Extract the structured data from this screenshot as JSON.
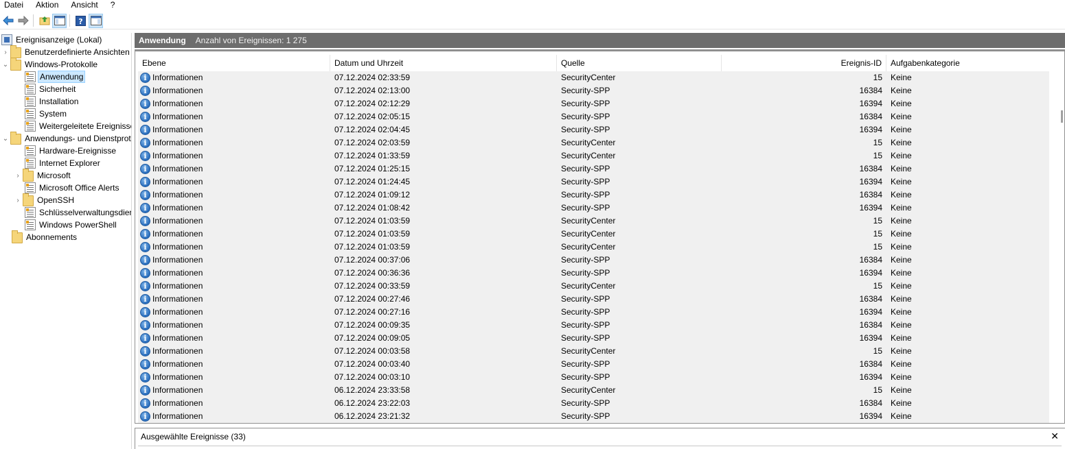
{
  "menu": [
    "Datei",
    "Aktion",
    "Ansicht",
    "?"
  ],
  "toolbar": {
    "back_icon": "back-arrow-icon",
    "forward_icon": "forward-arrow-icon",
    "up_icon": "folder-up-icon",
    "console_icon": "console-tree-icon",
    "help_icon": "help-icon",
    "panel_icon": "action-pane-icon"
  },
  "tree": {
    "root": "Ereignisanzeige (Lokal)",
    "custom_views": "Benutzerdefinierte Ansichten",
    "windows_logs": "Windows-Protokolle",
    "windows_logs_items": [
      "Anwendung",
      "Sicherheit",
      "Installation",
      "System",
      "Weitergeleitete Ereignisse"
    ],
    "app_service_logs": "Anwendungs- und Dienstprotokolle",
    "app_service_items": [
      "Hardware-Ereignisse",
      "Internet Explorer",
      "Microsoft",
      "Microsoft Office Alerts",
      "OpenSSH",
      "Schlüsselverwaltungsdienst",
      "Windows PowerShell"
    ],
    "subscriptions": "Abonnements"
  },
  "main": {
    "title": "Anwendung",
    "event_count": "Anzahl von Ereignissen: 1 275",
    "columns": [
      "Ebene",
      "Datum und Uhrzeit",
      "Quelle",
      "Ereignis-ID",
      "Aufgabenkategorie"
    ],
    "rows": [
      [
        "Informationen",
        "07.12.2024 02:33:59",
        "SecurityCenter",
        "15",
        "Keine"
      ],
      [
        "Informationen",
        "07.12.2024 02:13:00",
        "Security-SPP",
        "16384",
        "Keine"
      ],
      [
        "Informationen",
        "07.12.2024 02:12:29",
        "Security-SPP",
        "16394",
        "Keine"
      ],
      [
        "Informationen",
        "07.12.2024 02:05:15",
        "Security-SPP",
        "16384",
        "Keine"
      ],
      [
        "Informationen",
        "07.12.2024 02:04:45",
        "Security-SPP",
        "16394",
        "Keine"
      ],
      [
        "Informationen",
        "07.12.2024 02:03:59",
        "SecurityCenter",
        "15",
        "Keine"
      ],
      [
        "Informationen",
        "07.12.2024 01:33:59",
        "SecurityCenter",
        "15",
        "Keine"
      ],
      [
        "Informationen",
        "07.12.2024 01:25:15",
        "Security-SPP",
        "16384",
        "Keine"
      ],
      [
        "Informationen",
        "07.12.2024 01:24:45",
        "Security-SPP",
        "16394",
        "Keine"
      ],
      [
        "Informationen",
        "07.12.2024 01:09:12",
        "Security-SPP",
        "16384",
        "Keine"
      ],
      [
        "Informationen",
        "07.12.2024 01:08:42",
        "Security-SPP",
        "16394",
        "Keine"
      ],
      [
        "Informationen",
        "07.12.2024 01:03:59",
        "SecurityCenter",
        "15",
        "Keine"
      ],
      [
        "Informationen",
        "07.12.2024 01:03:59",
        "SecurityCenter",
        "15",
        "Keine"
      ],
      [
        "Informationen",
        "07.12.2024 01:03:59",
        "SecurityCenter",
        "15",
        "Keine"
      ],
      [
        "Informationen",
        "07.12.2024 00:37:06",
        "Security-SPP",
        "16384",
        "Keine"
      ],
      [
        "Informationen",
        "07.12.2024 00:36:36",
        "Security-SPP",
        "16394",
        "Keine"
      ],
      [
        "Informationen",
        "07.12.2024 00:33:59",
        "SecurityCenter",
        "15",
        "Keine"
      ],
      [
        "Informationen",
        "07.12.2024 00:27:46",
        "Security-SPP",
        "16384",
        "Keine"
      ],
      [
        "Informationen",
        "07.12.2024 00:27:16",
        "Security-SPP",
        "16394",
        "Keine"
      ],
      [
        "Informationen",
        "07.12.2024 00:09:35",
        "Security-SPP",
        "16384",
        "Keine"
      ],
      [
        "Informationen",
        "07.12.2024 00:09:05",
        "Security-SPP",
        "16394",
        "Keine"
      ],
      [
        "Informationen",
        "07.12.2024 00:03:58",
        "SecurityCenter",
        "15",
        "Keine"
      ],
      [
        "Informationen",
        "07.12.2024 00:03:40",
        "Security-SPP",
        "16384",
        "Keine"
      ],
      [
        "Informationen",
        "07.12.2024 00:03:10",
        "Security-SPP",
        "16394",
        "Keine"
      ],
      [
        "Informationen",
        "06.12.2024 23:33:58",
        "SecurityCenter",
        "15",
        "Keine"
      ],
      [
        "Informationen",
        "06.12.2024 23:22:03",
        "Security-SPP",
        "16384",
        "Keine"
      ],
      [
        "Informationen",
        "06.12.2024 23:21:32",
        "Security-SPP",
        "16394",
        "Keine"
      ]
    ]
  },
  "bottom": {
    "title": "Ausgewählte Ereignisse (33)",
    "close": "✕"
  },
  "colors": {
    "header_bg": "#6d6d6d",
    "row_bg": "#f0f0f0",
    "selected_bg": "#cce8ff",
    "info_blue": "#2a6ebd"
  }
}
